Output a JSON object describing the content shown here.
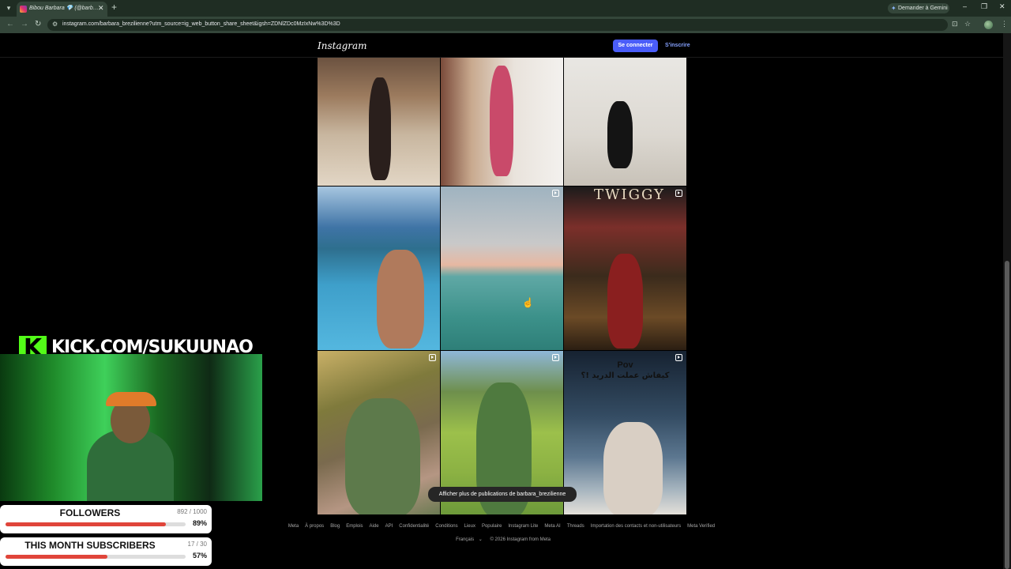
{
  "browser": {
    "tab_title": "Bibou Barbara 💎 (@barb…",
    "tab_close": "✕",
    "new_tab": "+",
    "gemini_label": "Demander à Gemini",
    "url": "instagram.com/barbara_brezilienne?utm_source=ig_web_button_share_sheet&igsh=ZDNlZDc0MzIxNw%3D%3D"
  },
  "instagram": {
    "logo": "Instagram",
    "login_label": "Se connecter",
    "signup_label": "S'inscrire",
    "post_overlay_twiggy": "TWIGGY",
    "post_overlay_pov": "Pov",
    "post_overlay_arabic": "كيفاش عملت الدريد !؟",
    "show_more_label": "Afficher plus de publications de barbara_brezilienne",
    "footer_links": [
      "Meta",
      "À propos",
      "Blog",
      "Emplois",
      "Aide",
      "API",
      "Confidentialité",
      "Conditions",
      "Lieux",
      "Populaire",
      "Instagram Lite",
      "Meta AI",
      "Threads",
      "Importation des contacts et non-utilisateurs",
      "Meta Verified"
    ],
    "footer_language": "Français",
    "footer_copyright": "© 2026 Instagram from Meta"
  },
  "overlay": {
    "kick_logo": "K",
    "kick_url": "KICK.COM/SUKUUNAO",
    "followers": {
      "label": "FOLLOWERS",
      "count": "892 / 1000",
      "percent_text": "89%",
      "fraction": 0.892
    },
    "subscribers": {
      "label": "THIS MONTH SUBSCRIBERS",
      "count": "17 / 30",
      "percent_text": "57%",
      "fraction": 0.567
    }
  },
  "colors": {
    "accent": "#4a5df9",
    "kick_green": "#53fc18",
    "progress": "#e0453a"
  },
  "icons": [
    "tab-list-icon",
    "instagram-favicon",
    "back-icon",
    "forward-icon",
    "reload-icon",
    "site-info-icon",
    "install-icon",
    "star-icon",
    "reel-icon",
    "cursor-icon"
  ]
}
